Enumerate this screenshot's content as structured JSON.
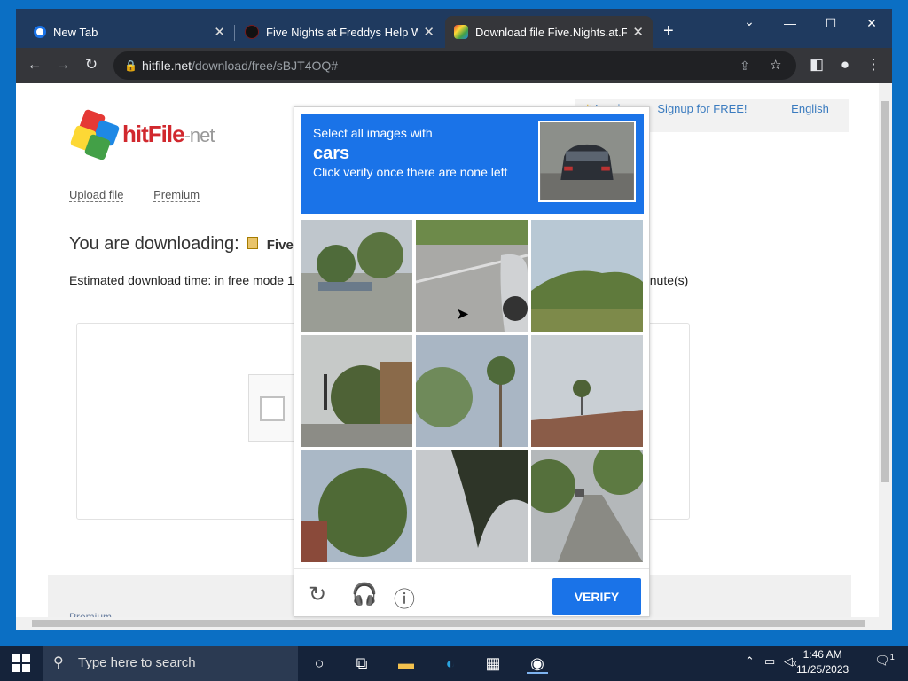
{
  "browser": {
    "tabs": [
      {
        "title": "New Tab",
        "icon": "chrome-icon"
      },
      {
        "title": "Five Nights at Freddys Help Want",
        "icon": "freddy-icon"
      },
      {
        "title": "Download file Five.Nights.at.Fre",
        "icon": "hitfile-icon"
      }
    ],
    "url_host": "hitfile.net",
    "url_path": "/download/free/sBJT4OQ#"
  },
  "page": {
    "logo_text": "hitFile",
    "logo_suffix": "-net",
    "upload_link": "Upload file",
    "premium_link": "Premium",
    "login": "Log in",
    "or": "or",
    "signup": "Signup for FREE!",
    "language": "English",
    "downloading_label": "You are downloading:",
    "file_name": "Five.I",
    "estimate": "Estimated download time: in free mode 1",
    "estimate_tail": "minute(s)",
    "footer_premium": "Premium"
  },
  "captcha": {
    "line1": "Select all images with",
    "target": "cars",
    "line3": "Click verify once there are none left",
    "verify": "VERIFY"
  },
  "taskbar": {
    "search_placeholder": "Type here to search",
    "time": "1:46 AM",
    "date": "11/25/2023",
    "notification_count": "1"
  }
}
